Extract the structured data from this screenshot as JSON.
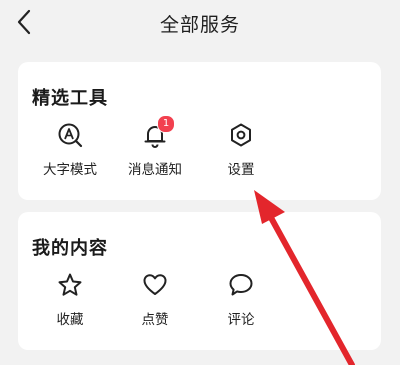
{
  "header": {
    "title": "全部服务",
    "back_icon": "chevron-left-icon"
  },
  "featured": {
    "title": "精选工具",
    "items": [
      {
        "label": "大字模式",
        "icon": "large-text-icon"
      },
      {
        "label": "消息通知",
        "icon": "bell-icon",
        "badge": "1"
      },
      {
        "label": "设置",
        "icon": "settings-icon"
      }
    ]
  },
  "my_content": {
    "title": "我的内容",
    "items": [
      {
        "label": "收藏",
        "icon": "star-icon"
      },
      {
        "label": "点赞",
        "icon": "heart-icon"
      },
      {
        "label": "评论",
        "icon": "comment-icon"
      }
    ]
  },
  "colors": {
    "badge": "#f2404f",
    "annotation_arrow": "#e3262c"
  }
}
